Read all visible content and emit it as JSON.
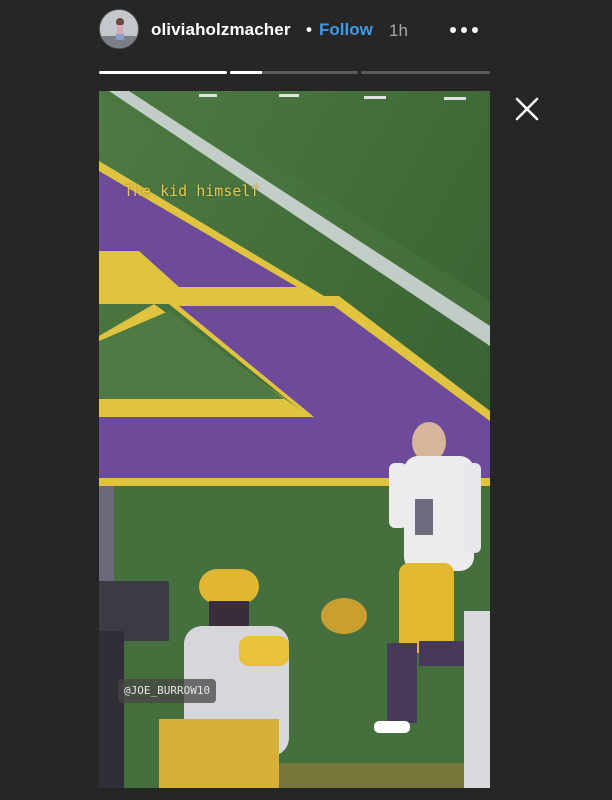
{
  "header": {
    "username": "oliviaholzmacher",
    "separator": "•",
    "follow_label": "Follow",
    "time_ago": "1h",
    "more_icon": "more-horizontal-icon",
    "close_icon": "close-icon",
    "follow_color": "#3d9be9"
  },
  "progress": [
    {
      "fraction": 1.0
    },
    {
      "fraction": 0.25
    },
    {
      "fraction": 0.0
    },
    {
      "fraction": 0.0
    }
  ],
  "story": {
    "caption": "The kid himself",
    "mention_tag": "@JOE_BURROW10",
    "caption_color": "#e9c84a"
  }
}
